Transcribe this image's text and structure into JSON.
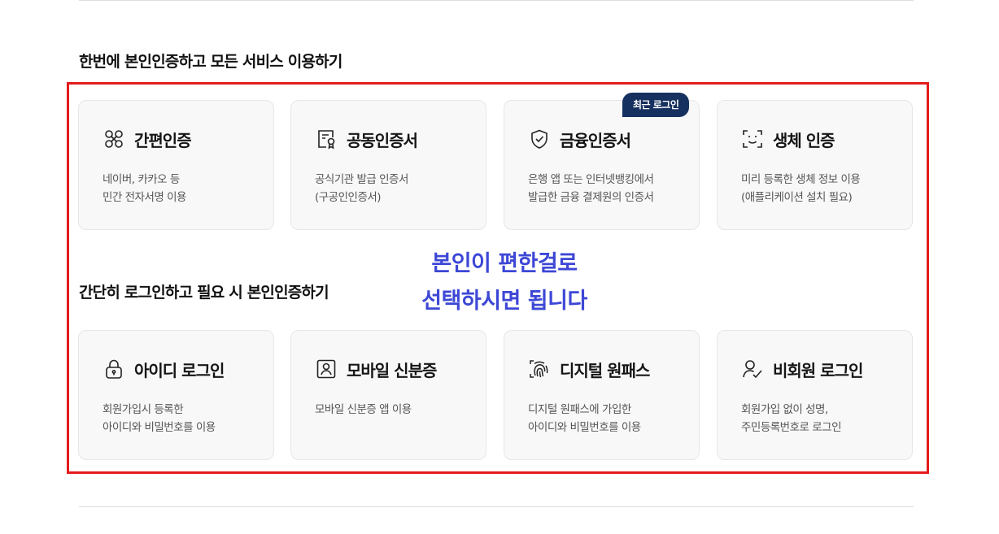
{
  "section1": {
    "title": "한번에 본인인증하고 모든 서비스 이용하기"
  },
  "section2": {
    "title": "간단히 로그인하고 필요 시 본인인증하기"
  },
  "badge": {
    "label": "최근 로그인"
  },
  "annotation": {
    "line1": "본인이 편한걸로",
    "line2": "선택하시면 됩니다",
    "color": "#3d47d6"
  },
  "accent": {
    "highlight_border": "#e41b1b",
    "badge_bg": "#16305f"
  },
  "auth_methods": [
    {
      "icon": "simple-auth-icon",
      "title": "간편인증",
      "desc": [
        "네이버, 카카오 등",
        "민간 전자서명 이용"
      ]
    },
    {
      "icon": "certificate-icon",
      "title": "공동인증서",
      "desc": [
        "공식기관 발급 인증서",
        "(구공인인증서)"
      ]
    },
    {
      "icon": "shield-check-icon",
      "title": "금융인증서",
      "desc": [
        "은행 앱 또는 인터넷뱅킹에서",
        "발급한 금융 결제원의 인증서"
      ]
    },
    {
      "icon": "face-scan-icon",
      "title": "생체 인증",
      "desc": [
        "미리 등록한 생체 정보 이용",
        "(애플리케이션 설치 필요)"
      ]
    }
  ],
  "login_methods": [
    {
      "icon": "lock-icon",
      "title": "아이디 로그인",
      "desc": [
        "회원가입시 등록한",
        "아이디와 비밀번호를 이용"
      ]
    },
    {
      "icon": "id-card-icon",
      "title": "모바일 신분증",
      "desc": [
        "모바일 신분증 앱 이용"
      ]
    },
    {
      "icon": "fingerprint-icon",
      "title": "디지털 원패스",
      "desc": [
        "디지털 원패스에 가입한",
        "아이디와 비밀번호를 이용"
      ]
    },
    {
      "icon": "user-check-icon",
      "title": "비회원 로그인",
      "desc": [
        "회원가입 없이 성명,",
        "주민등록번호로 로그인"
      ]
    }
  ]
}
